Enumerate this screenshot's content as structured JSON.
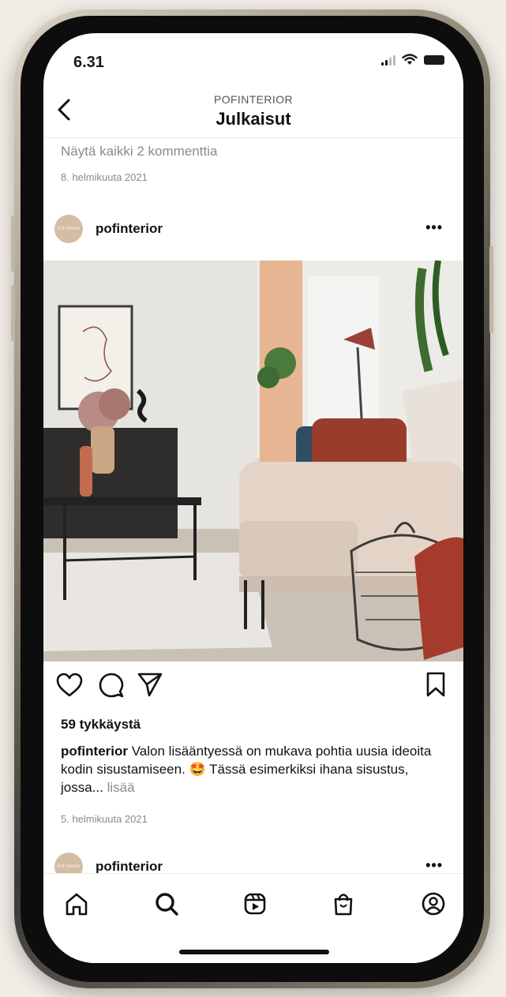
{
  "status_bar": {
    "time": "6.31"
  },
  "header": {
    "subtitle": "POFINTERIOR",
    "title": "Julkaisut"
  },
  "previous_post": {
    "view_comments": "Näytä kaikki 2 kommenttia",
    "date": "8. helmikuuta 2021"
  },
  "post": {
    "username": "pofinterior",
    "avatar_text": "Pof Interior",
    "more_label": "•••",
    "likes": "59 tykkäystä",
    "caption_user": "pofinterior",
    "caption_text": "Valon lisääntyessä on mukava pohtia uusia ideoita kodin sisustamiseen. 🤩 Tässä esimerkiksi ihana sisustus, jossa...",
    "caption_more": "lisää",
    "date": "5. helmikuuta 2021",
    "photo_icon": "living-room-photo"
  },
  "next_post": {
    "username": "pofinterior",
    "avatar_text": "Pof Interior",
    "more_label": "•••"
  },
  "icons": {
    "back": "back-arrow-icon",
    "like": "heart-icon",
    "comment": "comment-icon",
    "share": "send-icon",
    "save": "bookmark-icon",
    "nav": [
      "home-icon",
      "search-icon",
      "reels-icon",
      "shop-icon",
      "profile-icon"
    ]
  },
  "colors": {
    "background": "#f1ece6",
    "screen": "#ffffff",
    "text": "#111111",
    "muted": "#8a8a8a",
    "avatar": "#d3bea4"
  }
}
